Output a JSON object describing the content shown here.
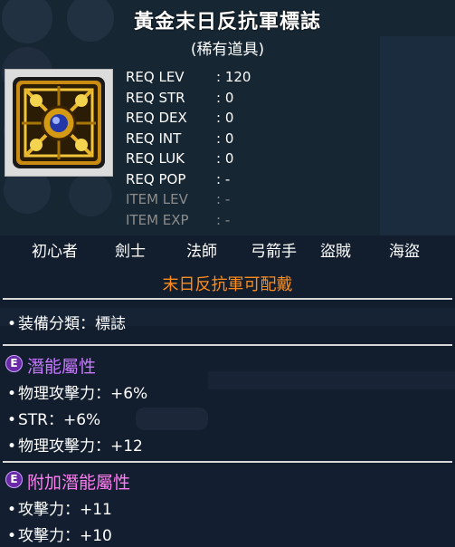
{
  "item": {
    "name": "黃金末日反抗軍標誌",
    "rarity": "(稀有道具)",
    "icon": "resistance-emblem-icon"
  },
  "requirements": [
    {
      "label": "REQ LEV",
      "value": "120",
      "dim": false
    },
    {
      "label": "REQ STR",
      "value": "0",
      "dim": false
    },
    {
      "label": "REQ DEX",
      "value": "0",
      "dim": false
    },
    {
      "label": "REQ INT",
      "value": "0",
      "dim": false
    },
    {
      "label": "REQ LUK",
      "value": "0",
      "dim": false
    },
    {
      "label": "REQ POP",
      "value": "-",
      "dim": false
    },
    {
      "label": "ITEM LEV",
      "value": "-",
      "dim": true
    },
    {
      "label": "ITEM EXP",
      "value": "-",
      "dim": true
    }
  ],
  "jobs": [
    "初心者",
    "劍士",
    "法師",
    "弓箭手",
    "盜賊",
    "海盜"
  ],
  "equip_note": "末日反抗軍可配戴",
  "category": "装備分類：標誌",
  "potential": {
    "badge": "E",
    "title": "潛能屬性",
    "lines": [
      "物理攻擊力：+6%",
      "STR：+6%",
      "物理攻擊力：+12"
    ]
  },
  "bonus_potential": {
    "badge": "E",
    "title": "附加潛能屬性",
    "lines": [
      "攻擊力：+11",
      "攻擊力：+10"
    ]
  },
  "colors": {
    "background": "#0a1420",
    "title_text": "#ffffff",
    "equip_note": "#ff8c1a",
    "potential_title": "#c678ff",
    "bonus_potential_title": "#ff7cf0",
    "dim_text": "#8c8c8c"
  }
}
